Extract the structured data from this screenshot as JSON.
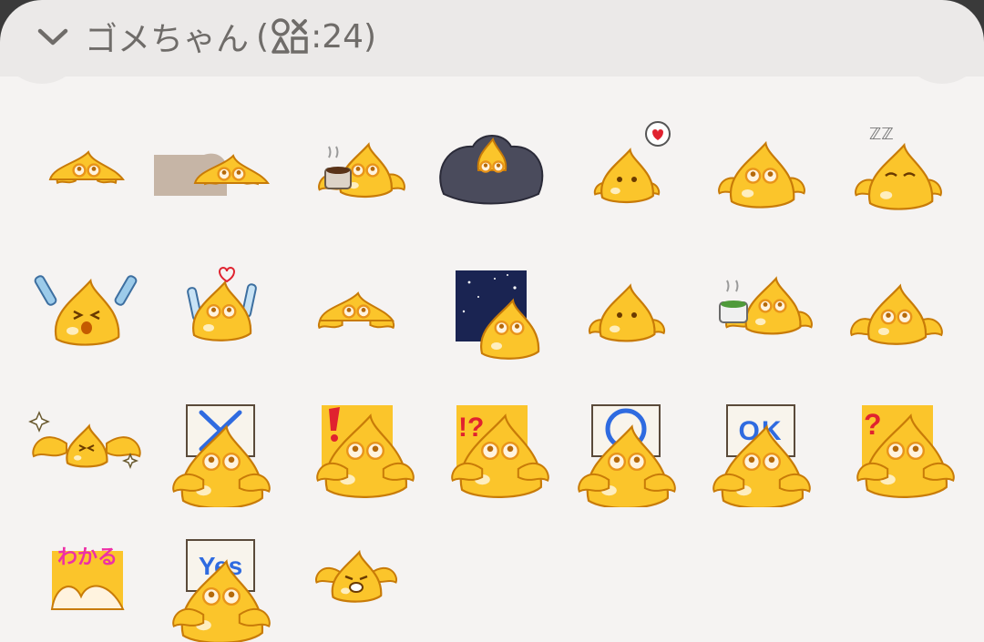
{
  "header": {
    "name": "ゴメちゃん",
    "count_prefix": "(",
    "count_text": ":24)",
    "collapse_icon": "chevron-down-icon",
    "category_icon": "shapes-icon"
  },
  "colors": {
    "body": "#fbc52b",
    "body_dark": "#e49d12",
    "outline": "#c87b08",
    "eye_white": "#fff3df",
    "eye_ring": "#e8941a",
    "board": "#f8f4ec",
    "mark_blue": "#2f6be0",
    "mark_red": "#e0222f",
    "mark_pink": "#ee2fa6",
    "space": "#1a2452"
  },
  "stickers": [
    {
      "id": "sticker-1",
      "variant": "lying-flat"
    },
    {
      "id": "sticker-2",
      "variant": "held-by-hand"
    },
    {
      "id": "sticker-3",
      "variant": "with-coffee-cup"
    },
    {
      "id": "sticker-4",
      "variant": "in-dark-blanket"
    },
    {
      "id": "sticker-5",
      "variant": "heart-speech-bubble"
    },
    {
      "id": "sticker-6",
      "variant": "looking-up"
    },
    {
      "id": "sticker-7",
      "variant": "sleepy-zzz"
    },
    {
      "id": "sticker-8",
      "variant": "cheering-glow-sticks"
    },
    {
      "id": "sticker-9",
      "variant": "glow-sticks-heart"
    },
    {
      "id": "sticker-10",
      "variant": "lying-flat-2"
    },
    {
      "id": "sticker-11",
      "variant": "starry-space"
    },
    {
      "id": "sticker-12",
      "variant": "simple-smile"
    },
    {
      "id": "sticker-13",
      "variant": "with-tea-cup"
    },
    {
      "id": "sticker-14",
      "variant": "peeking"
    },
    {
      "id": "sticker-15",
      "variant": "flying-sparkles"
    },
    {
      "id": "sticker-16",
      "variant": "sign-x"
    },
    {
      "id": "sticker-17",
      "variant": "exclamation"
    },
    {
      "id": "sticker-18",
      "variant": "exclamation-question"
    },
    {
      "id": "sticker-19",
      "variant": "sign-o"
    },
    {
      "id": "sticker-20",
      "variant": "sign-ok",
      "sign_text": "OK"
    },
    {
      "id": "sticker-21",
      "variant": "question"
    },
    {
      "id": "sticker-22",
      "variant": "wakaru",
      "caption": "わかる"
    },
    {
      "id": "sticker-23",
      "variant": "sign-yes",
      "sign_text": "Yes"
    },
    {
      "id": "sticker-24",
      "variant": "crying"
    }
  ]
}
